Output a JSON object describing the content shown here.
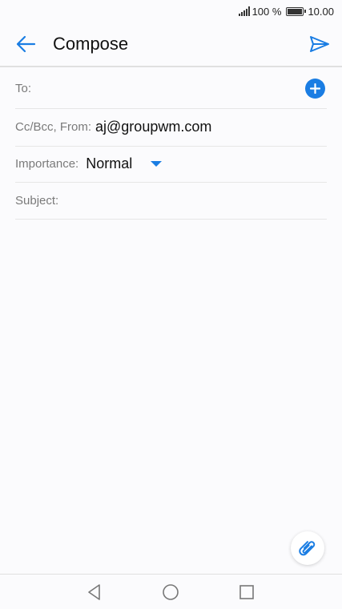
{
  "status_bar": {
    "battery_text": "100 %",
    "time": "10.00"
  },
  "app_bar": {
    "title": "Compose",
    "back_icon": "arrow-left-icon",
    "send_icon": "send-icon"
  },
  "form": {
    "to_label": "To:",
    "cc_label": "Cc/Bcc, From:",
    "from_value": "aj@groupwm.com",
    "importance_label": "Importance:",
    "importance_value": "Normal",
    "subject_label": "Subject:"
  },
  "colors": {
    "accent": "#1a7de3"
  },
  "nav_bar": {
    "icons": [
      "back-triangle-icon",
      "home-circle-icon",
      "recents-square-icon"
    ]
  }
}
